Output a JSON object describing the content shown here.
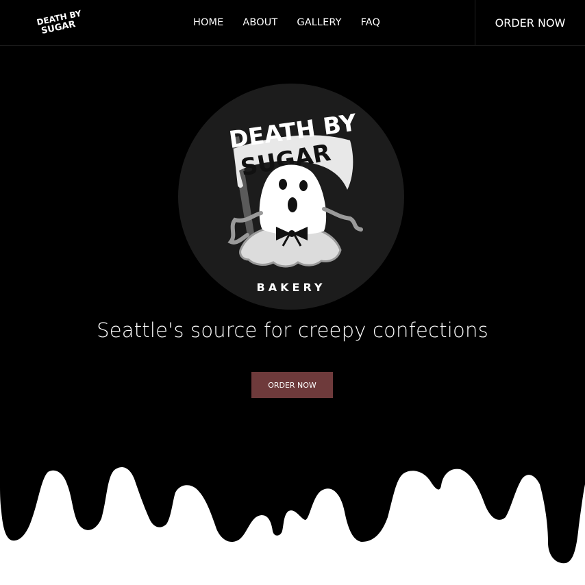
{
  "header": {
    "logo_text": [
      "DEATH BY",
      "SUGAR"
    ],
    "nav": [
      "HOME",
      "ABOUT",
      "GALLERY",
      "FAQ"
    ],
    "order_label": "ORDER NOW"
  },
  "hero": {
    "badge": {
      "title_line1": "DEATH BY",
      "title_line2": "SUGAR",
      "subtitle": "BAKERY"
    },
    "tagline": "Seattle's source for creepy confections",
    "cta_label": "ORDER NOW"
  },
  "colors": {
    "background": "#000000",
    "cta": "#6e3a3b",
    "badge_circle": "#1c1c1c",
    "drip": "#ffffff"
  },
  "icons": [
    "ghost-icon",
    "scythe-icon",
    "bow-icon"
  ]
}
